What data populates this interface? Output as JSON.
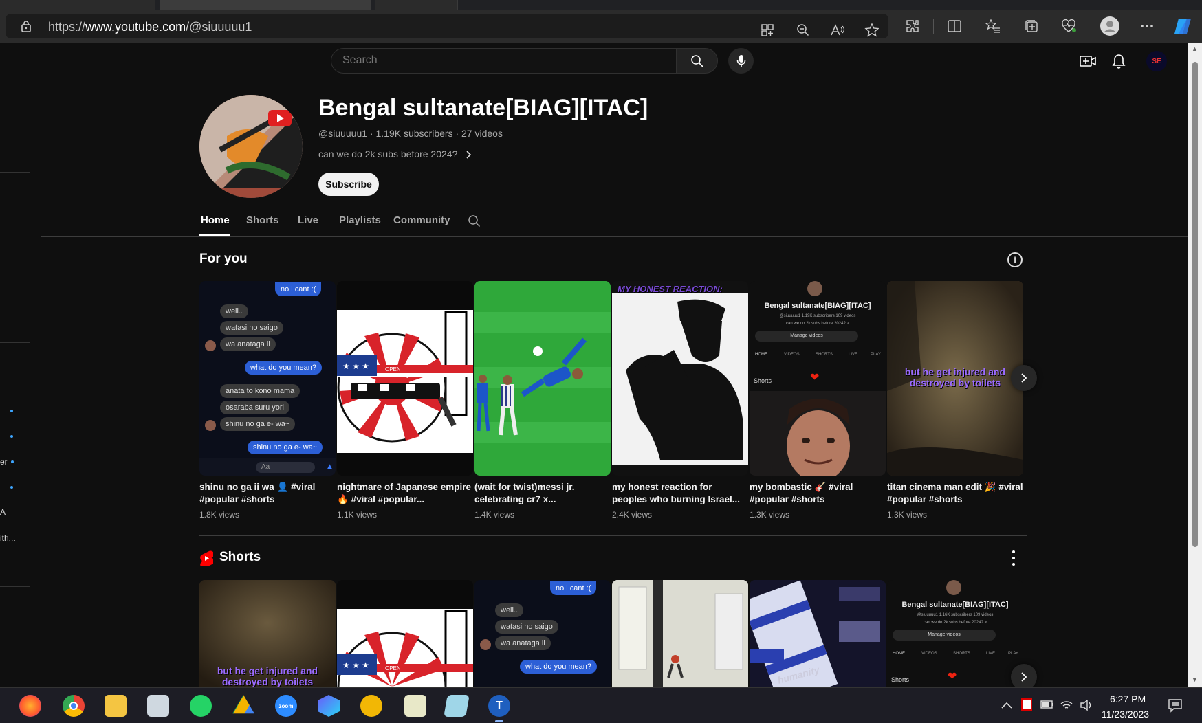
{
  "browser": {
    "url": "https://www.youtube.com/@siuuuuu1",
    "url_prefix": "https://",
    "url_host": "www.youtube.com",
    "url_path": "/@siuuuuu1"
  },
  "sidebar_fragments": [
    "er",
    "A",
    "ith..."
  ],
  "masthead": {
    "search_placeholder": "Search",
    "avatar_text": "SE"
  },
  "channel": {
    "title": "Bengal sultanate[BIAG][ITAC]",
    "handle": "@siuuuuu1",
    "subscribers": "1.19K subscribers",
    "videos": "27 videos",
    "meta_separator": " · ",
    "description": "can we do 2k subs before 2024?",
    "subscribe_label": "Subscribe"
  },
  "tabs": [
    "Home",
    "Shorts",
    "Live",
    "Playlists",
    "Community"
  ],
  "for_you": {
    "title": "For you",
    "items": [
      {
        "title": "shinu no ga ii wa 👤 #viral #popular #shorts",
        "views": "1.8K views"
      },
      {
        "title": "nightmare of Japanese empire 🔥 #viral #popular...",
        "views": "1.1K views"
      },
      {
        "title": "(wait for twist)messi jr. celebrating cr7 x...",
        "views": "1.4K views"
      },
      {
        "title": "my honest reaction for peoples who burning Israel...",
        "views": "2.4K views"
      },
      {
        "title": "my bombastic 🎸 #viral #popular #shorts",
        "views": "1.3K views"
      },
      {
        "title": "titan cinema man edit 🎉 #viral #popular #shorts",
        "views": "1.3K views"
      }
    ]
  },
  "shorts": {
    "title": "Shorts"
  },
  "thumb_text": {
    "chat": {
      "top": "no i cant :(",
      "lines": [
        "well..",
        "watasi no saigo",
        "wa anataga ii",
        "what do you mean?",
        "anata to kono mama",
        "osaraba suru yori",
        "shinu no ga e- wa~",
        "shinu no ga e- wa~"
      ],
      "input": "Aa"
    },
    "flag_label": "OPEN",
    "reaction_caption": "MY HONEST REACTION:",
    "toilet_caption": "but he get injured and destroyed by toilets",
    "mini_channel": {
      "title": "Bengal sultanate[BIAG][ITAC]",
      "meta": "@siuuuuu1 1.19K subscribers 109 videos",
      "meta_short": "@siuuuuu1 1.16K subscribers 109 videos",
      "desc": "can we do 2k subs before 2024? >",
      "manage": "Manage videos",
      "tabs": [
        "HOME",
        "VIDEOS",
        "SHORTS",
        "LIVE",
        "PLAY"
      ],
      "shorts_label": "Shorts"
    },
    "humanity": "humanity"
  },
  "taskbar": {
    "time": "6:27 PM",
    "date": "11/23/2023",
    "apps": [
      "firefox",
      "chrome",
      "file-explorer",
      "keyboard-app",
      "whatsapp",
      "google-drive",
      "zoom",
      "app-hex",
      "medal-app",
      "notepad-app",
      "folder-app",
      "t-app"
    ],
    "zoom_label": "zoom"
  },
  "colors": {
    "background": "#0f0f0f",
    "accent_red": "#ff0000",
    "blue_bubble": "#2c5fd6",
    "caption_purple": "#9b6bff"
  }
}
